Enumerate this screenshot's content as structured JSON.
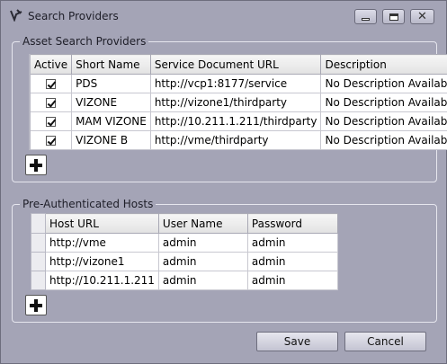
{
  "window": {
    "title": "Search Providers"
  },
  "asset_group": {
    "label": "Asset Search Providers",
    "columns": [
      "Active",
      "Short Name",
      "Service Document URL",
      "Description"
    ],
    "rows": [
      {
        "active": true,
        "short_name": "PDS",
        "url": "http://vcp1:8177/service",
        "description": "No Description Available"
      },
      {
        "active": true,
        "short_name": "VIZONE",
        "url": "http://vizone1/thirdparty",
        "description": "No Description Available"
      },
      {
        "active": true,
        "short_name": "MAM VIZONE",
        "url": "http://10.211.1.211/thirdparty",
        "description": "No Description Available"
      },
      {
        "active": true,
        "short_name": "VIZONE B",
        "url": "http://vme/thirdparty",
        "description": "No Description Available"
      }
    ]
  },
  "hosts_group": {
    "label": "Pre-Authenticated Hosts",
    "columns": [
      "Host URL",
      "User Name",
      "Password"
    ],
    "rows": [
      {
        "host": "http://vme",
        "user": "admin",
        "password": "admin"
      },
      {
        "host": "http://vizone1",
        "user": "admin",
        "password": "admin"
      },
      {
        "host": "http://10.211.1.211",
        "user": "admin",
        "password": "admin"
      }
    ]
  },
  "buttons": {
    "save": "Save",
    "cancel": "Cancel"
  },
  "icons": {
    "app": "app-logo-icon",
    "add": "plus-icon",
    "minimize": "minimize-icon",
    "maximize": "maximize-icon",
    "close": "close-icon"
  }
}
